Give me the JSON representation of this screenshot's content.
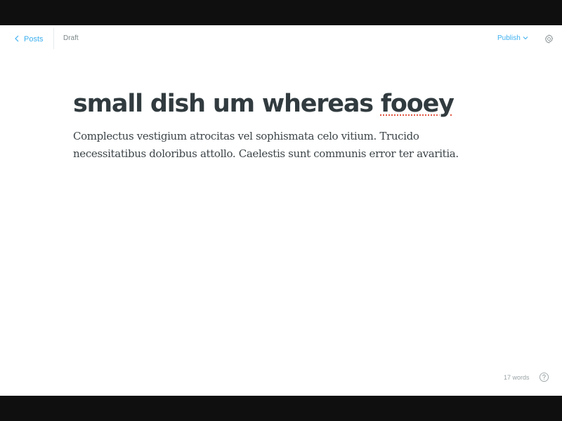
{
  "nav": {
    "back_label": "Posts",
    "status": "Draft",
    "publish_label": "Publish",
    "back_icon": "chevron-left-icon",
    "publish_icon": "chevron-down-icon",
    "settings_icon": "gear-icon"
  },
  "post": {
    "title_prefix": "small dish um whereas ",
    "title_misspelled": "fooey",
    "body": "Complectus vestigium atrocitas vel sophismata celo vitium. Trucido necessitatibus doloribus attollo. Caelestis sunt communis error ter avaritia."
  },
  "footer": {
    "word_count": "17 words",
    "help_icon": "question-circle-icon"
  },
  "colors": {
    "accent": "#3eb0ef",
    "title": "#313b3f",
    "body": "#3c4448",
    "muted": "#9aa3a6",
    "background": "#ffffff",
    "letterbox": "#0f0f10"
  }
}
